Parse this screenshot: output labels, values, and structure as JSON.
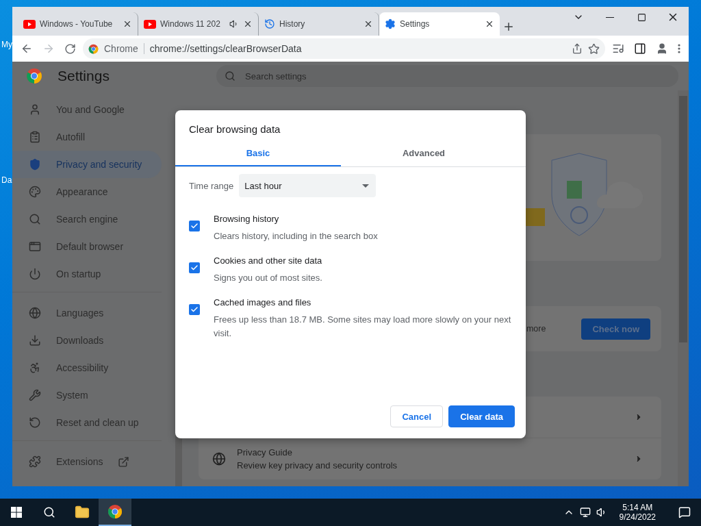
{
  "desktop": {
    "icon_labels": [
      "My",
      "Da"
    ]
  },
  "browser": {
    "tabs": [
      {
        "title": "Windows - YouTube",
        "playing_audio": false,
        "selected": false
      },
      {
        "title": "Windows 11 202",
        "playing_audio": true,
        "selected": false
      },
      {
        "title": "History",
        "playing_audio": false,
        "selected": false
      },
      {
        "title": "Settings",
        "playing_audio": false,
        "selected": true
      }
    ],
    "toolbar": {
      "site_chip": "Chrome",
      "url": "chrome://settings/clearBrowserData"
    }
  },
  "settings": {
    "title": "Settings",
    "search": {
      "placeholder": "Search settings"
    },
    "sidebar": {
      "groups": [
        [
          {
            "label": "You and Google",
            "selected": false
          },
          {
            "label": "Autofill",
            "selected": false
          },
          {
            "label": "Privacy and security",
            "selected": true
          },
          {
            "label": "Appearance",
            "selected": false
          },
          {
            "label": "Search engine",
            "selected": false
          },
          {
            "label": "Default browser",
            "selected": false
          },
          {
            "label": "On startup",
            "selected": false
          }
        ],
        [
          {
            "label": "Languages",
            "selected": false
          },
          {
            "label": "Downloads",
            "selected": false
          },
          {
            "label": "Accessibility",
            "selected": false
          },
          {
            "label": "System",
            "selected": false
          },
          {
            "label": "Reset and clean up",
            "selected": false
          }
        ],
        [
          {
            "label": "Extensions",
            "selected": false
          }
        ]
      ]
    },
    "safety_check": {
      "text": "more",
      "button": "Check now"
    },
    "rows": [
      {
        "title": "Privacy Guide",
        "subtitle": "Review key privacy and security controls"
      }
    ]
  },
  "dialog": {
    "title": "Clear browsing data",
    "tabs": [
      {
        "label": "Basic",
        "selected": true
      },
      {
        "label": "Advanced",
        "selected": false
      }
    ],
    "time_range": {
      "label": "Time range",
      "value": "Last hour"
    },
    "options": [
      {
        "title": "Browsing history",
        "description": "Clears history, including in the search box",
        "checked": true
      },
      {
        "title": "Cookies and other site data",
        "description": "Signs you out of most sites.",
        "checked": true
      },
      {
        "title": "Cached images and files",
        "description": "Frees up less than 18.7 MB. Some sites may load more slowly on your next visit.",
        "checked": true
      }
    ],
    "buttons": {
      "cancel": "Cancel",
      "confirm": "Clear data"
    }
  },
  "taskbar": {
    "time": "5:14 AM",
    "date": "9/24/2022"
  }
}
